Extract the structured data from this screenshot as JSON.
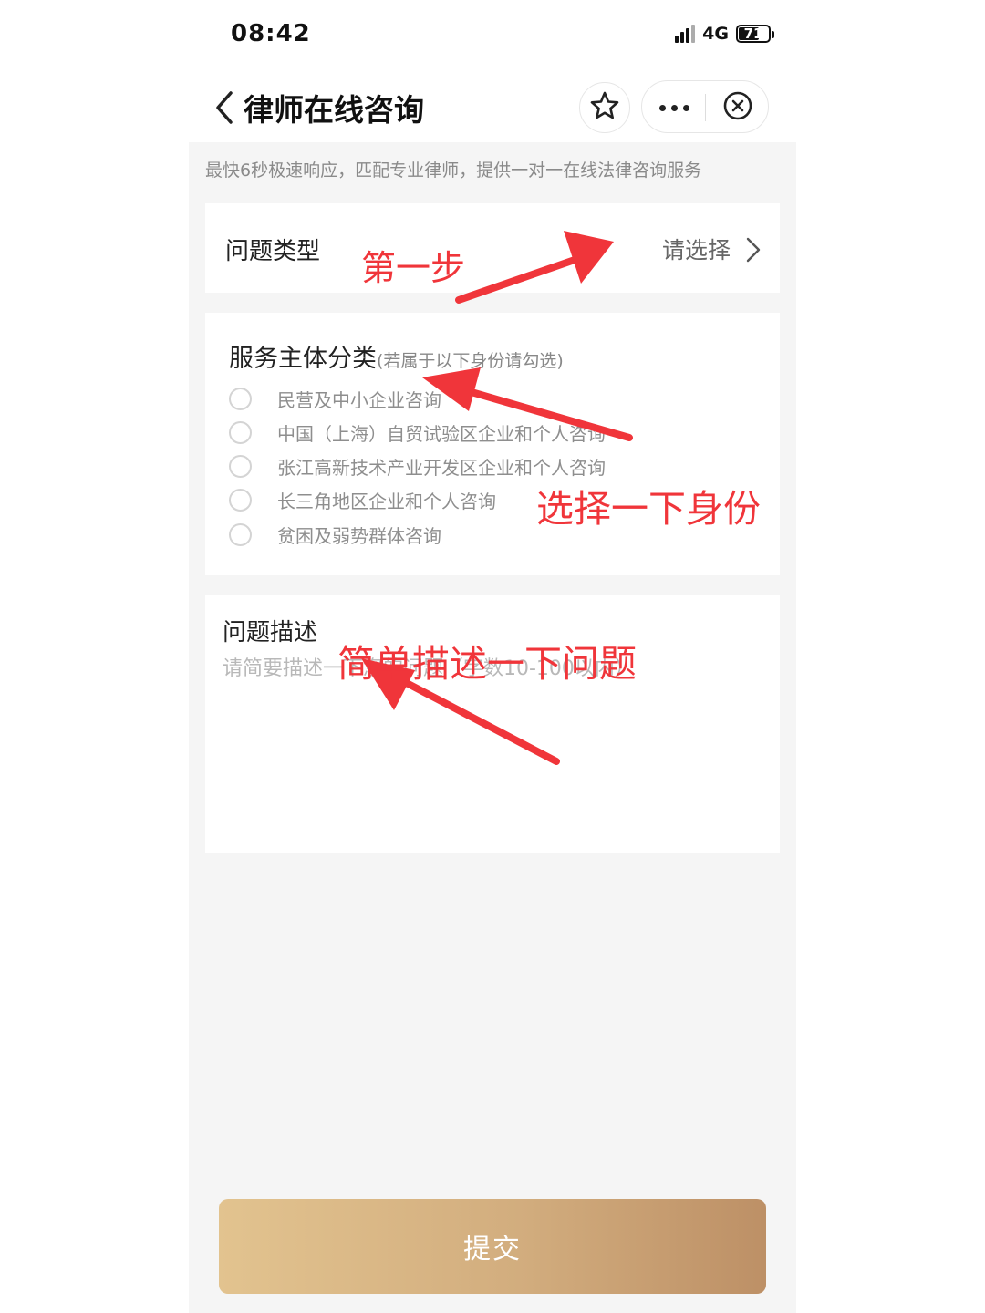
{
  "status_bar": {
    "time": "08:42",
    "network": "4G",
    "battery": "71",
    "battery_level": 0.71
  },
  "nav": {
    "title": "律师在线咨询",
    "back_icon": "chevron-left-icon",
    "favorite_icon": "star-icon",
    "more_icon": "more-dots-icon",
    "close_icon": "close-circle-icon"
  },
  "banner": {
    "text": "最快6秒极速响应，匹配专业律师，提供一对一在线法律咨询服务"
  },
  "question_type": {
    "label": "问题类型",
    "value": "请选择"
  },
  "service_subject": {
    "title": "服务主体分类",
    "hint": "(若属于以下身份请勾选)",
    "options": [
      "民营及中小企业咨询",
      "中国（上海）自贸试验区企业和个人咨询",
      "张江高新技术产业开发区企业和个人咨询",
      "长三角地区企业和个人咨询",
      "贫困及弱势群体咨询"
    ]
  },
  "description": {
    "label": "问题描述",
    "placeholder": "请简要描述一下您的问题（字数10-100以内）"
  },
  "submit": {
    "label": "提交"
  },
  "annotations": {
    "step1": "第一步",
    "step2": "选择一下身份",
    "step3": "简单描述一下问题",
    "color": "#f0353a"
  },
  "colors": {
    "submit_gradient_start": "#e2c38f",
    "submit_gradient_end": "#bd9066",
    "background": "#f5f5f5"
  }
}
